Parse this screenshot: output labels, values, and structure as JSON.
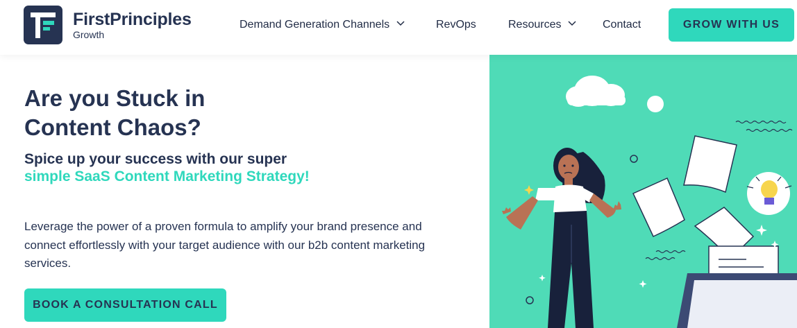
{
  "brand": {
    "name": "FirstPrinciples",
    "tagline": "Growth",
    "colors": {
      "primary": "#263352",
      "accent": "#2fd8bc",
      "hero_bg": "#4fdbb7"
    }
  },
  "nav": {
    "items": [
      {
        "label": "Demand Generation Channels",
        "has_dropdown": true
      },
      {
        "label": "RevOps",
        "has_dropdown": false
      },
      {
        "label": "Resources",
        "has_dropdown": true
      },
      {
        "label": "Contact",
        "has_dropdown": false
      }
    ],
    "cta_label": "GROW WITH US"
  },
  "hero": {
    "headline_line1": "Are you Stuck in",
    "headline_line2": "Content Chaos?",
    "subheadline_line1": "Spice up your success with our super",
    "subheadline_line2": "simple SaaS Content Marketing Strategy!",
    "body": "Leverage the power of a proven formula to amplify your brand presence and connect effortlessly with your target audience with our b2b content marketing services.",
    "cta_label": "BOOK A CONSULTATION CALL"
  },
  "illustration": {
    "icons": [
      "cloud-icon",
      "lightbulb-icon",
      "paper-sheet-icon",
      "laptop-icon",
      "sparkle-icon"
    ]
  }
}
